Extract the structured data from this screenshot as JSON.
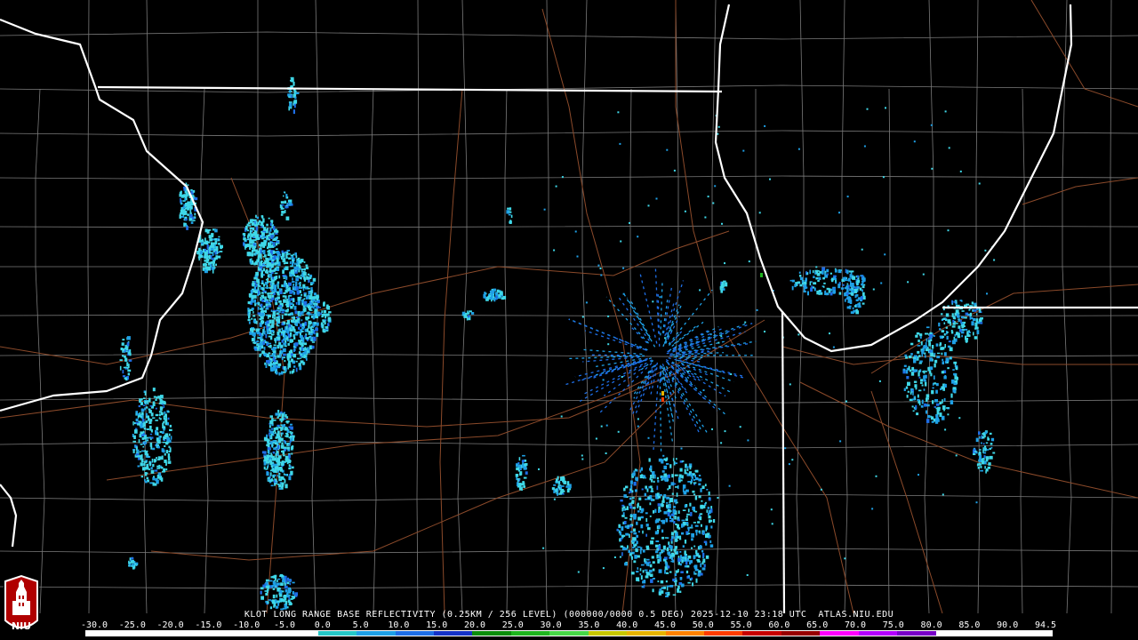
{
  "caption": "KLOT LONG RANGE BASE REFLECTIVITY (0.25KM / 256 LEVEL) (000000/0000 0.5 DEG) 2025-12-10 23:18 UTC  ATLAS.NIU.EDU",
  "logo": {
    "text": "NIU",
    "icon": "university-tower-icon"
  },
  "scale": {
    "labels": [
      "-30.0",
      "-25.0",
      "-20.0",
      "-15.0",
      "-10.0",
      "-5.0",
      "0.0",
      "5.0",
      "10.0",
      "15.0",
      "20.0",
      "25.0",
      "30.0",
      "35.0",
      "40.0",
      "45.0",
      "50.0",
      "55.0",
      "60.0",
      "65.0",
      "70.0",
      "75.0",
      "80.0",
      "85.0",
      "90.0",
      "94.5"
    ],
    "colors": [
      "#ffffff",
      "#ffffff",
      "#ffffff",
      "#ffffff",
      "#ffffff",
      "#ffffff",
      "#25c8c8",
      "#1ea0e6",
      "#1e6ee6",
      "#1432c8",
      "#0a8c0a",
      "#1eb41e",
      "#46d746",
      "#c8c800",
      "#e6b400",
      "#ff8200",
      "#ff3c00",
      "#c80000",
      "#960000",
      "#ff00ff",
      "#b400ff",
      "#7800c8",
      "#ffffff",
      "#ffffff",
      "#ffffff"
    ]
  },
  "colors": {
    "background": "#000000",
    "state_border": "#ffffff",
    "county_border": "#7a7a7a",
    "highway": "#8b4a2a",
    "echo_light": "#3fd8e8",
    "echo_mid": "#1ea0e6",
    "echo_strong": "#1e6ee6"
  }
}
